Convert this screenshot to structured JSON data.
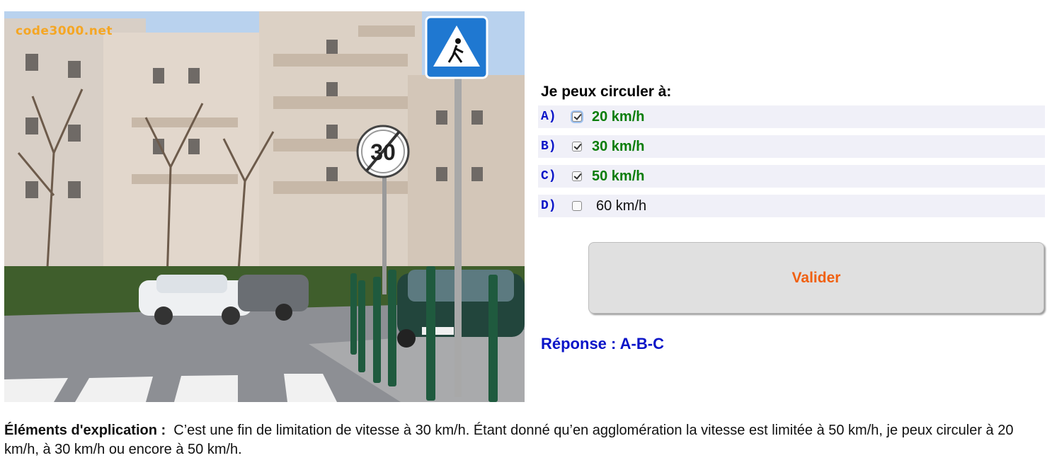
{
  "photo": {
    "watermark": "code3000.net",
    "sign_speed_value": "30"
  },
  "question": {
    "prompt": "Je peux circuler à:",
    "options": [
      {
        "letter": "A)",
        "label": "20 km/h",
        "checked": true,
        "correct": true
      },
      {
        "letter": "B)",
        "label": "30 km/h",
        "checked": true,
        "correct": true
      },
      {
        "letter": "C)",
        "label": "50 km/h",
        "checked": true,
        "correct": true
      },
      {
        "letter": "D)",
        "label": "60 km/h",
        "checked": false,
        "correct": false
      }
    ],
    "submit_label": "Valider",
    "answer": "Réponse : A-B-C"
  },
  "explanation": {
    "heading": "Éléments d'explication :",
    "text": "C’est une fin de limitation de vitesse à 30 km/h. Étant donné qu’en agglomération la vitesse est limitée à 50 km/h, je peux circuler à 20 km/h, à 30 km/h ou encore à 50 km/h."
  },
  "colors": {
    "correct": "#0a7d0a",
    "letter": "#0a14c8",
    "button_text": "#f06010",
    "answer": "#0a14c8"
  }
}
